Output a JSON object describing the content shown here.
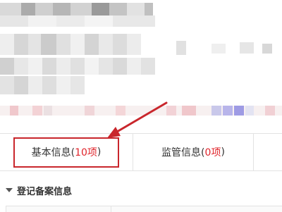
{
  "tabs": [
    {
      "label": "基本信息(",
      "count": "10项",
      "suffix": ")",
      "highlighted": true
    },
    {
      "label": "监管信息(",
      "count": "0项",
      "suffix": ")"
    }
  ],
  "section": {
    "title": "登记备案信息",
    "icon": "caret-down-icon"
  },
  "colors": {
    "accent_red": "#e0242b",
    "highlight_border": "#c9262c",
    "border": "#e3e3e3"
  }
}
